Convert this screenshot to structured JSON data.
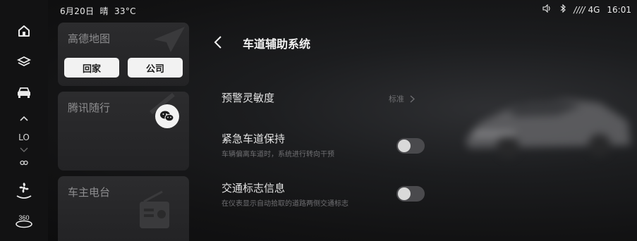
{
  "status": {
    "date": "6月20日",
    "weather": "晴",
    "temp": "33°C",
    "network": "4G",
    "time": "16:01",
    "signal": "////"
  },
  "rail": {
    "level": "LO"
  },
  "cards": {
    "map": {
      "title": "高德地图",
      "home_label": "回家",
      "work_label": "公司"
    },
    "tencent": {
      "title": "腾讯随行"
    },
    "radio": {
      "title": "车主电台"
    }
  },
  "page": {
    "title": "车道辅助系统"
  },
  "settings": {
    "sensitivity": {
      "label": "预警灵敏度",
      "value": "标准"
    },
    "lane_keep": {
      "label": "紧急车道保持",
      "desc": "车辆偏离车道时，系统进行转向干预",
      "enabled": false
    },
    "traffic_sign": {
      "label": "交通标志信息",
      "desc": "在仪表显示自动拾取的道路两侧交通标志",
      "enabled": false
    }
  }
}
